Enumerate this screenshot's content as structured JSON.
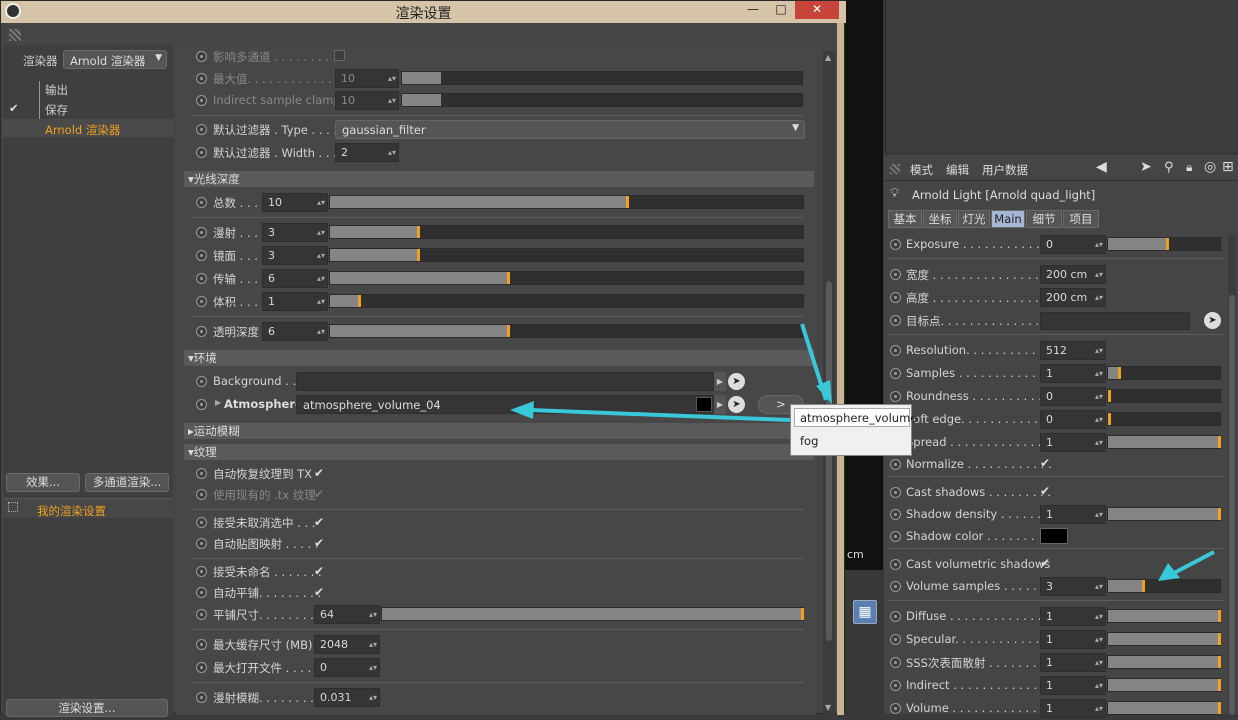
{
  "window": {
    "title": "渲染设置",
    "min": "—",
    "max": "□",
    "close": "✕"
  },
  "left": {
    "renderer_label": "渲染器",
    "renderer_value": "Arnold 渲染器",
    "items": [
      "输出",
      "保存",
      "Arnold 渲染器"
    ],
    "effects_button": "效果...",
    "multipass_button": "多通道渲染...",
    "preset": "我的渲染设置",
    "render_settings_button": "渲染设置..."
  },
  "main": {
    "rows_top": [
      {
        "label": "影响多通道 . . . . . . . . . .",
        "dim": true
      },
      {
        "label": "最大值. . . . . . . . . . . . .",
        "value": "10",
        "dim": true
      },
      {
        "label": "Indirect sample clamp",
        "value": "10",
        "dim": true
      }
    ],
    "filter_type_label": "默认过滤器 . Type . . . .",
    "filter_type_value": "gaussian_filter",
    "filter_width_label": "默认过滤器 . Width . . .",
    "filter_width_value": "2",
    "sec_ray": "光线深度",
    "ray": [
      {
        "label": "总数 . . .",
        "value": "10"
      },
      {
        "label": "漫射 . . .",
        "value": "3"
      },
      {
        "label": "镜面 . . .",
        "value": "3"
      },
      {
        "label": "传输 . . .",
        "value": "6"
      },
      {
        "label": "体积 . . .",
        "value": "1"
      },
      {
        "label": "透明深度",
        "value": "6"
      }
    ],
    "sec_env": "环境",
    "background_label": "Background . .",
    "atmosphere_label": "Atmosphere",
    "atmosphere_value": "atmosphere_volume_04",
    "arrow_btn": ">",
    "sec_motion": "运动模糊",
    "sec_tex": "纹理",
    "tex": [
      {
        "label": "自动恢复纹理到 TX",
        "check": "✔"
      },
      {
        "label": "使用现有的 .tx 纹理",
        "check": "✔",
        "dim": true
      },
      {
        "label": "接受未取消选中 . . .",
        "check": "✔"
      },
      {
        "label": "自动贴图映射 . . . . .",
        "check": "✔"
      },
      {
        "label": "接受未命名 . . . . . . .",
        "check": "✔"
      },
      {
        "label": "自动平铺. . . . . . . . .",
        "check": "✔"
      }
    ],
    "tile_label": "平铺尺寸. . . . . . . . .",
    "tile_value": "64",
    "cache_label": "最大缓存尺寸 (MB)",
    "cache_value": "2048",
    "open_label": "最大打开文件 . . . .",
    "open_value": "0",
    "blur_label": "漫射模糊. . . . . . . . .",
    "blur_value": "0.031"
  },
  "popup": {
    "items": [
      "atmosphere_volume",
      "fog"
    ]
  },
  "right": {
    "menu": [
      "模式",
      "编辑",
      "用户数据"
    ],
    "object_title": "Arnold Light [Arnold quad_light]",
    "tabs": [
      "基本",
      "坐标",
      "灯光",
      "Main",
      "细节",
      "项目"
    ],
    "rows": [
      {
        "label": "Exposure . . . . . . . . . . . . .",
        "value": "0"
      },
      {
        "label": "宽度 . . . . . . . . . . . . . . . .",
        "value": "200 cm"
      },
      {
        "label": "高度 . . . . . . . . . . . . . . . .",
        "value": "200 cm"
      },
      {
        "label": "目标点. . . . . . . . . . . . . . .",
        "value": ""
      },
      {
        "label": "Resolution. . . . . . . . . . . .",
        "value": "512"
      },
      {
        "label": "Samples . . . . . . . . . . . . .",
        "value": "1"
      },
      {
        "label": "Roundness . . . . . . . . . . .",
        "value": "0"
      },
      {
        "label": "Soft edge. . . . . . . . . . . .",
        "value": "0"
      },
      {
        "label": "Spread . . . . . . . . . . . . . .",
        "value": "1"
      },
      {
        "label": "Normalize . . . . . . . . . . . .",
        "value": "✔"
      },
      {
        "label": "Cast shadows . . . . . . . . .",
        "value": "✔"
      },
      {
        "label": "Shadow density . . . . . . .",
        "value": "1"
      },
      {
        "label": "Shadow color . . . . . . .",
        "value": ""
      },
      {
        "label": "Cast volumetric shadows",
        "value": "✔"
      },
      {
        "label": "Volume samples . . . . . . .",
        "value": "3"
      },
      {
        "label": "Diffuse . . . . . . . . . . . . . .",
        "value": "1"
      },
      {
        "label": "Specular. . . . . . . . . . . . .",
        "value": "1"
      },
      {
        "label": "SSS次表面散射 . . . . . . .",
        "value": "1"
      },
      {
        "label": "Indirect . . . . . . . . . . . . .",
        "value": "1"
      },
      {
        "label": "Volume . . . . . . . . . . . . . .",
        "value": "1"
      }
    ],
    "viewport_unit": "cm"
  },
  "colors": {
    "accent": "#f0a020",
    "arrow": "#38c8d8",
    "active_tab": "#a6b7d6"
  }
}
